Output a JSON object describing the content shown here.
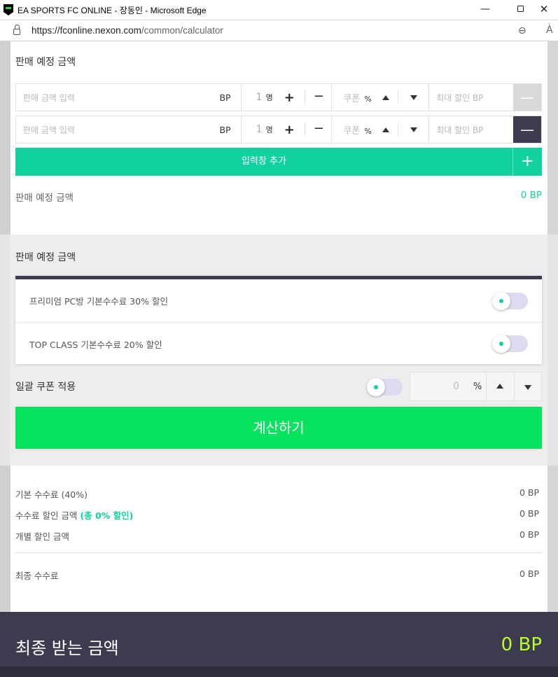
{
  "browser": {
    "title": "EA SPORTS FC ONLINE - 장동인 - Microsoft Edge",
    "url_host": "https://fconline.nexon.com",
    "url_path": "/common/calculator",
    "aa_label": "À"
  },
  "window_controls": {
    "minimize": "—",
    "close": "✕"
  },
  "section1": {
    "title": "판매 예정 금액",
    "rows": [
      {
        "amount_placeholder": "판매 금액 입력",
        "amount_unit": "BP",
        "qty": "1",
        "qty_unit": "명",
        "coupon_placeholder": "쿠폰",
        "coupon_unit": "%",
        "max_placeholder": "최대 할인 BP",
        "remove_enabled": false
      },
      {
        "amount_placeholder": "판매 금액 입력",
        "amount_unit": "BP",
        "qty": "1",
        "qty_unit": "명",
        "coupon_placeholder": "쿠폰",
        "coupon_unit": "%",
        "max_placeholder": "최대 할인 BP",
        "remove_enabled": true
      }
    ],
    "add_label": "입력창 추가",
    "total_label": "판매 예정 금액",
    "total_value": "0 BP"
  },
  "section2": {
    "title": "판매 예정 금액",
    "options": [
      {
        "label": "프리미엄 PC방 기본수수료 30% 할인"
      },
      {
        "label": "TOP CLASS 기본수수료 20% 할인"
      }
    ],
    "bulk_label": "일괄 쿠폰 적용",
    "bulk_value": "0",
    "bulk_unit": "%",
    "calc_label": "계산하기"
  },
  "summary": {
    "base_fee_label": "기본 수수료 (40%)",
    "base_fee_value": "0 BP",
    "discount_label": "수수료 할인 금액",
    "discount_highlight": "(총 0% 할인)",
    "discount_value": "0 BP",
    "individual_label": "개별 할인 금액",
    "individual_value": "0 BP",
    "final_fee_label": "최종 수수료",
    "final_fee_value": "0 BP"
  },
  "footer": {
    "label": "최종 받는 금액",
    "value": "0 BP"
  },
  "colors": {
    "accent_teal": "#12d1a0",
    "calc_green": "#07e35f",
    "dark_navy": "#3d3b50",
    "final_value": "#b7ff2a"
  }
}
